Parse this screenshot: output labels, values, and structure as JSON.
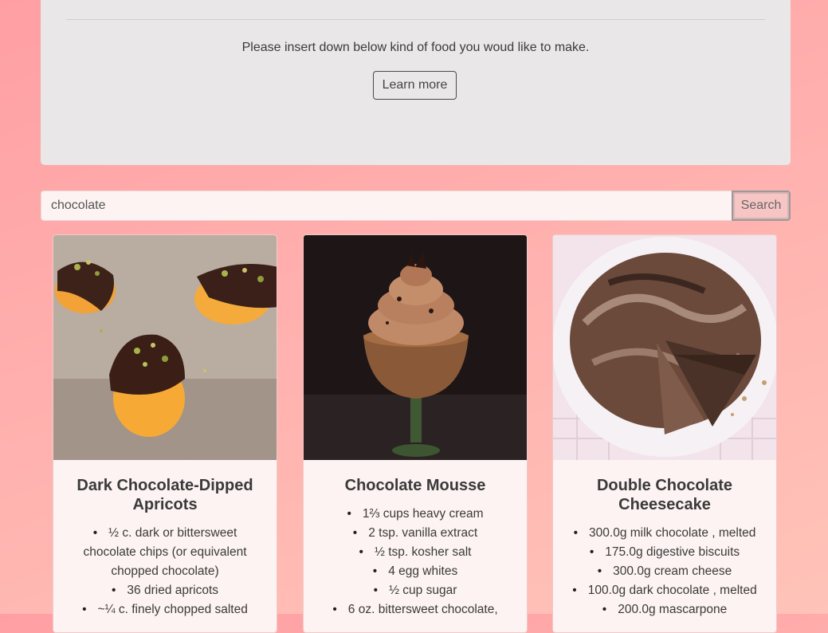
{
  "hero": {
    "lead_text": "Please insert down below kind of food you woud like to make.",
    "learn_more_label": "Learn more"
  },
  "search": {
    "value": "chocolate",
    "button_label": "Search"
  },
  "recipes": [
    {
      "title": "Dark Chocolate-Dipped Apricots",
      "ingredients": [
        "½ c. dark or bittersweet chocolate chips (or equivalent chopped chocolate)",
        "36 dried apricots",
        "~¼ c. finely chopped salted"
      ]
    },
    {
      "title": "Chocolate Mousse",
      "ingredients": [
        "1⅔ cups heavy cream",
        "2 tsp. vanilla extract",
        "½ tsp. kosher salt",
        "4 egg whites",
        "½ cup sugar",
        "6 oz. bittersweet chocolate,"
      ]
    },
    {
      "title": "Double Chocolate Cheesecake",
      "ingredients": [
        "300.0g milk chocolate , melted",
        "175.0g digestive biscuits",
        "300.0g cream cheese",
        "100.0g dark chocolate , melted",
        "200.0g mascarpone"
      ]
    }
  ]
}
